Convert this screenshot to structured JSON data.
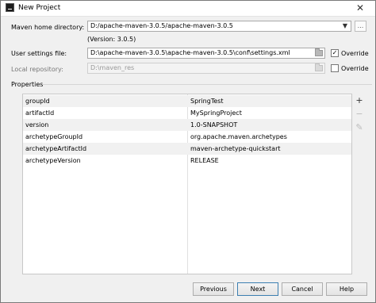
{
  "window": {
    "title": "New Project",
    "close_glyph": "✕"
  },
  "maven_home": {
    "label": "Maven home directory:",
    "value": "D:/apache-maven-3.0.5/apache-maven-3.0.5",
    "version_note": "(Version: 3.0.5)",
    "browse_label": "..."
  },
  "user_settings": {
    "label": "User settings file:",
    "value": "D:\\apache-maven-3.0.5\\apache-maven-3.0.5\\conf\\settings.xml",
    "override_label": "Override",
    "override_checked": true,
    "check_glyph": "✓"
  },
  "local_repo": {
    "label": "Local repository:",
    "value": "D:\\maven_res",
    "override_label": "Override",
    "override_checked": false
  },
  "properties": {
    "section_label": "Properties",
    "rows": [
      {
        "key": "groupId",
        "value": "SpringTest"
      },
      {
        "key": "artifactId",
        "value": "MySpringProject"
      },
      {
        "key": "version",
        "value": "1.0-SNAPSHOT"
      },
      {
        "key": "archetypeGroupId",
        "value": "org.apache.maven.archetypes"
      },
      {
        "key": "archetypeArtifactId",
        "value": "maven-archetype-quickstart"
      },
      {
        "key": "archetypeVersion",
        "value": "RELEASE"
      }
    ],
    "tools": {
      "add": "+",
      "remove": "−",
      "edit": "✎"
    }
  },
  "buttons": {
    "previous": "Previous",
    "next": "Next",
    "cancel": "Cancel",
    "help": "Help"
  },
  "icons": {
    "app": "app-icon",
    "close": "close-icon",
    "dropdown": "chevron-down-icon",
    "folder": "folder-icon",
    "add": "plus-icon",
    "remove": "minus-icon",
    "edit": "pencil-icon"
  },
  "colors": {
    "default_button_border": "#3c7fb1",
    "row_alt": "#f1f1f1"
  }
}
